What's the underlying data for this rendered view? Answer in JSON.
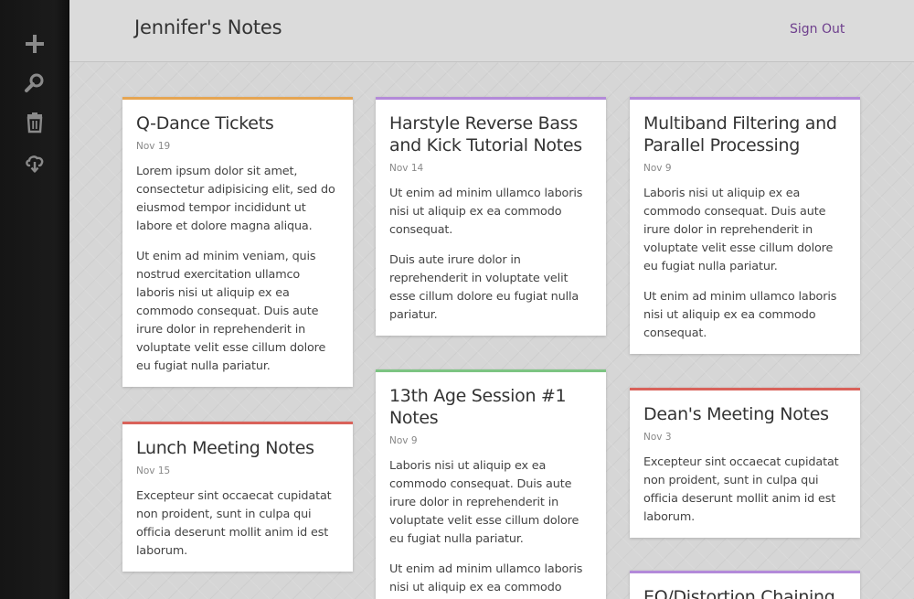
{
  "header": {
    "title": "Jennifer's Notes",
    "signout_label": "Sign Out"
  },
  "sidebar": {
    "items": [
      {
        "icon": "plus-icon",
        "action": "new-note"
      },
      {
        "icon": "search-icon",
        "action": "search"
      },
      {
        "icon": "trash-icon",
        "action": "trash"
      },
      {
        "icon": "cloud-sync-icon",
        "action": "sync"
      }
    ]
  },
  "notes": [
    {
      "title": "Q-Dance Tickets",
      "date": "Nov 19",
      "color": "#e5a552",
      "paragraphs": [
        "Lorem ipsum dolor sit amet, consectetur adipisicing elit, sed do eiusmod tempor incididunt ut labore et dolore magna aliqua.",
        "Ut enim ad minim veniam, quis nostrud exercitation ullamco laboris nisi ut aliquip ex ea commodo consequat. Duis aute irure dolor in reprehenderit in voluptate velit esse cillum dolore eu fugiat nulla pariatur."
      ]
    },
    {
      "title": "Lunch Meeting Notes",
      "date": "Nov 15",
      "color": "#d9625a",
      "paragraphs": [
        "Excepteur sint occaecat cupidatat non proident, sunt in culpa qui officia deserunt mollit anim id est laborum."
      ]
    },
    {
      "title": "Harstyle Reverse Bass and Kick Tutorial Notes",
      "date": "Nov 14",
      "color": "#b38ad9",
      "paragraphs": [
        "Ut enim ad minim ullamco laboris nisi ut aliquip ex ea commodo consequat.",
        "Duis aute irure dolor in reprehenderit in voluptate velit esse cillum dolore eu fugiat nulla pariatur."
      ]
    },
    {
      "title": "13th Age Session #1 Notes",
      "date": "Nov 9",
      "color": "#7cc482",
      "paragraphs": [
        "Laboris nisi ut aliquip ex ea commodo consequat. Duis aute irure dolor in reprehenderit in voluptate velit esse cillum dolore eu fugiat nulla pariatur.",
        "Ut enim ad minim ullamco laboris nisi ut aliquip ex ea commodo"
      ]
    },
    {
      "title": "Multiband Filtering and Parallel Processing",
      "date": "Nov 9",
      "color": "#b38ad9",
      "paragraphs": [
        "Laboris nisi ut aliquip ex ea commodo consequat. Duis aute irure dolor in reprehenderit in voluptate velit esse cillum dolore eu fugiat nulla pariatur.",
        "Ut enim ad minim ullamco laboris nisi ut aliquip ex ea commodo consequat."
      ]
    },
    {
      "title": "Dean's Meeting Notes",
      "date": "Nov 3",
      "color": "#d9625a",
      "paragraphs": [
        "Excepteur sint occaecat cupidatat non proident, sunt in culpa qui officia deserunt mollit anim id est laborum."
      ]
    },
    {
      "title": "EQ/Distortion Chaining",
      "date": "",
      "color": "#b38ad9",
      "paragraphs": []
    }
  ]
}
